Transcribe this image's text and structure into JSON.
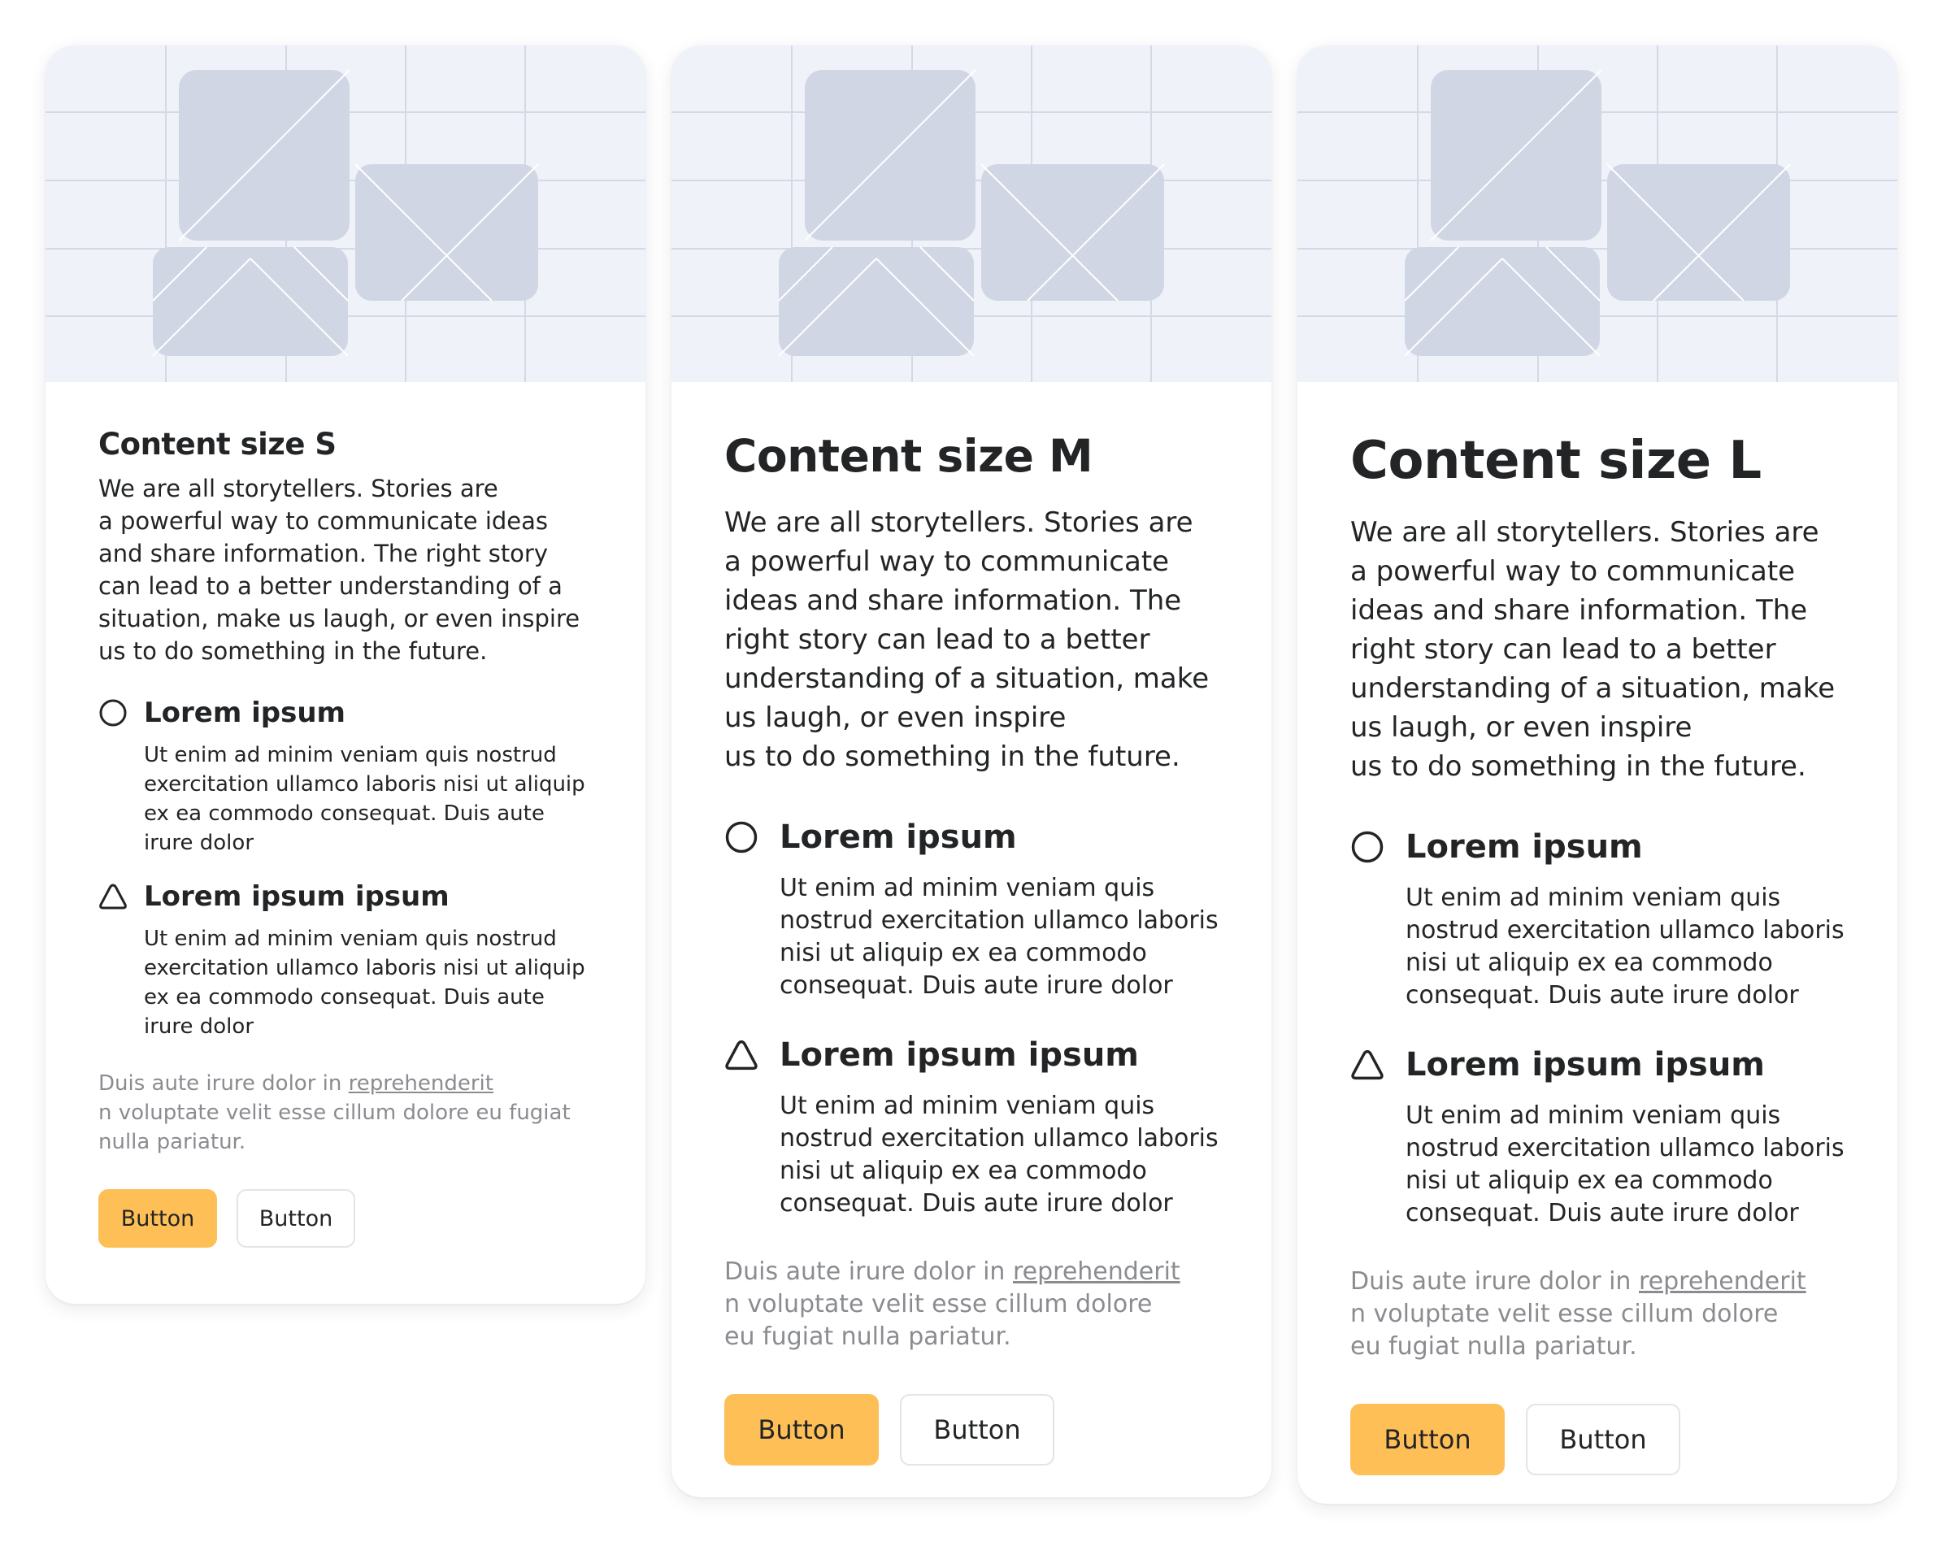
{
  "colors": {
    "page_background": "#ffffff",
    "card_background": "#ffffff",
    "hero_background": "#eff2f9",
    "hero_grid": "#d5d9e6",
    "placeholder_fill": "#d0d6e3",
    "text_primary": "#222426",
    "text_muted": "#8a8c90",
    "primary_button": "#ffbf57",
    "secondary_button_border": "#e2e4e8"
  },
  "cards": [
    {
      "size": "S",
      "title": "Content size S",
      "intro": "We are all storytellers. Stories are\na powerful way to communicate ideas and share information. The right story can lead to a better understanding of a situation, make us laugh, or even inspire\nus to do something in the future.",
      "features": [
        {
          "icon": "circle-icon",
          "title": "Lorem ipsum",
          "text": "Ut enim ad minim veniam quis nostrud exercitation ullamco laboris nisi ut aliquip ex ea commodo consequat. Duis aute irure dolor"
        },
        {
          "icon": "triangle-icon",
          "title": "Lorem ipsum ipsum",
          "text": "Ut enim ad minim veniam quis nostrud exercitation ullamco laboris nisi ut aliquip ex ea commodo consequat. Duis aute irure dolor"
        }
      ],
      "note": {
        "prefix": "Duis aute irure dolor in ",
        "link": "reprehenderit",
        "suffix": "\nn voluptate velit esse cillum dolore eu fugiat nulla pariatur."
      },
      "buttons": {
        "primary": "Button",
        "secondary": "Button"
      }
    },
    {
      "size": "M",
      "title": "Content size M",
      "intro": "We are all storytellers. Stories are\na powerful way to communicate ideas and share information. The right story can lead to a better understanding of a situation, make us laugh, or even inspire\nus to do something in the future.",
      "features": [
        {
          "icon": "circle-icon",
          "title": "Lorem ipsum",
          "text": "Ut enim ad minim veniam quis nostrud exercitation ullamco laboris nisi ut aliquip ex ea commodo consequat. Duis aute irure dolor"
        },
        {
          "icon": "triangle-icon",
          "title": "Lorem ipsum ipsum",
          "text": "Ut enim ad minim veniam quis nostrud exercitation ullamco laboris nisi ut aliquip ex ea commodo consequat. Duis aute irure dolor"
        }
      ],
      "note": {
        "prefix": "Duis aute irure dolor in ",
        "link": "reprehenderit",
        "suffix": "\nn voluptate velit esse cillum dolore\neu fugiat nulla pariatur."
      },
      "buttons": {
        "primary": "Button",
        "secondary": "Button"
      }
    },
    {
      "size": "L",
      "title": "Content size L",
      "intro": "We are all storytellers. Stories are\na powerful way to communicate ideas and share information. The right story can lead to a better understanding of a situation, make us laugh, or even inspire\nus to do something in the future.",
      "features": [
        {
          "icon": "circle-icon",
          "title": "Lorem ipsum",
          "text": "Ut enim ad minim veniam quis nostrud exercitation ullamco laboris nisi ut aliquip ex ea commodo consequat. Duis aute irure dolor"
        },
        {
          "icon": "triangle-icon",
          "title": "Lorem ipsum ipsum",
          "text": "Ut enim ad minim veniam quis nostrud exercitation ullamco laboris nisi ut aliquip ex ea commodo consequat. Duis aute irure dolor"
        }
      ],
      "note": {
        "prefix": "Duis aute irure dolor in ",
        "link": "reprehenderit",
        "suffix": "\nn voluptate velit esse cillum dolore\neu fugiat nulla pariatur."
      },
      "buttons": {
        "primary": "Button",
        "secondary": "Button"
      }
    }
  ]
}
